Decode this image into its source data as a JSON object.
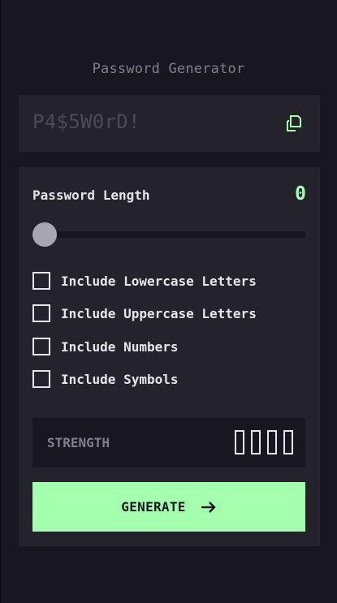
{
  "app": {
    "title": "Password Generator"
  },
  "output": {
    "password_placeholder": "P4$5W0rD!",
    "copy_icon": "copy-icon"
  },
  "settings": {
    "length_label": "Password Length",
    "length_value": "0",
    "slider_level": 0,
    "options": [
      {
        "label": "Include Lowercase Letters",
        "checked": false
      },
      {
        "label": "Include Uppercase Letters",
        "checked": false
      },
      {
        "label": "Include Numbers",
        "checked": false
      },
      {
        "label": "Include Symbols",
        "checked": false
      }
    ]
  },
  "strength": {
    "label": "STRENGTH",
    "bars_filled": 0,
    "bars_total": 4
  },
  "generate": {
    "label": "GENERATE",
    "icon": "arrow-right-icon"
  },
  "colors": {
    "background": "#18171f",
    "panel": "#24232c",
    "accent": "#a4ffaf",
    "muted": "#817d92",
    "text": "#e6e5ea"
  }
}
